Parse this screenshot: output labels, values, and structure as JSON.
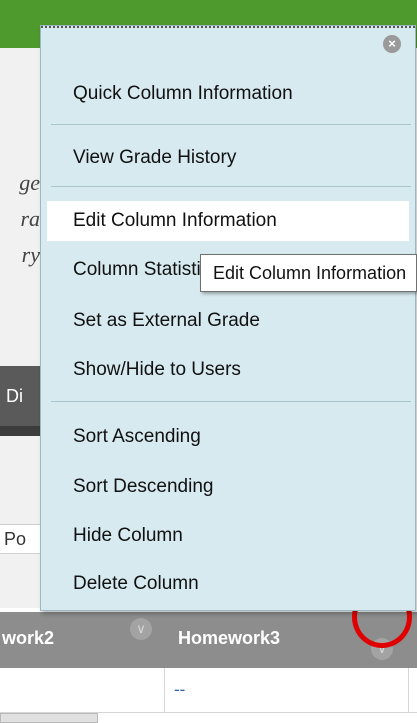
{
  "background": {
    "left_fragments": [
      "ge",
      "ra",
      "ry"
    ],
    "dark_tab_text": "Di",
    "input_text": "Po",
    "columns": [
      {
        "label": "work2"
      },
      {
        "label": "Homework3"
      }
    ],
    "cell_value": "--"
  },
  "menu": {
    "items": [
      {
        "label": "Quick Column Information"
      },
      {
        "label": "View Grade History"
      },
      {
        "label": "Edit Column Information"
      },
      {
        "label": "Column Statistics"
      },
      {
        "label": "Set as External Grade"
      },
      {
        "label": "Show/Hide to Users"
      },
      {
        "label": "Sort Ascending"
      },
      {
        "label": "Sort Descending"
      },
      {
        "label": "Hide Column"
      },
      {
        "label": "Delete Column"
      }
    ]
  },
  "tooltip": {
    "text": "Edit Column Information"
  },
  "colors": {
    "menu_bg": "#d7eaf0",
    "header_bg": "#8d8d8d",
    "annotation": "#e00000",
    "top_bar": "#4f9a2c"
  }
}
